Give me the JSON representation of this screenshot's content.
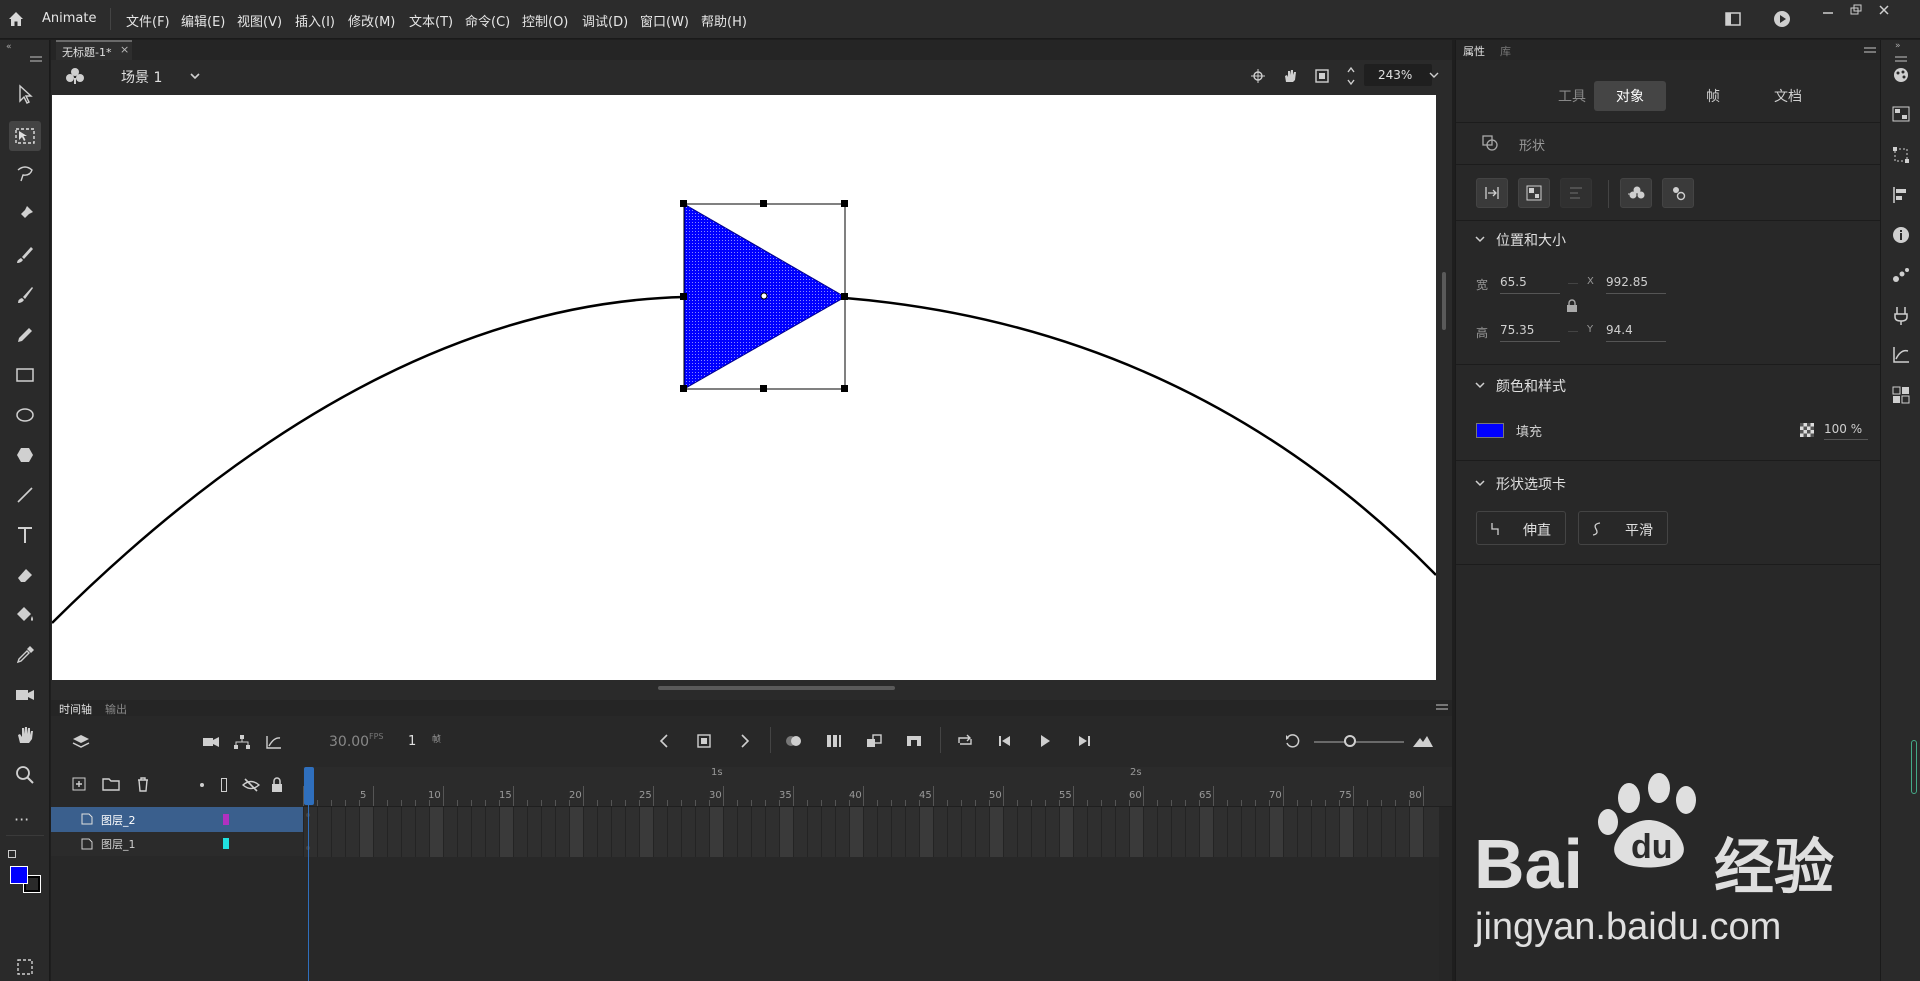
{
  "app": {
    "name": "Animate"
  },
  "menu": [
    "文件(F)",
    "编辑(E)",
    "视图(V)",
    "插入(I)",
    "修改(M)",
    "文本(T)",
    "命令(C)",
    "控制(O)",
    "调试(D)",
    "窗口(W)",
    "帮助(H)"
  ],
  "document": {
    "tab_title": "无标题-1*",
    "scene_label": "场景 1",
    "zoom": "243%"
  },
  "timeline": {
    "tab_active": "时间轴",
    "tab_inactive": "输出",
    "fps": "30.00",
    "fps_unit": "FPS",
    "frame": "1",
    "frame_unit": "帧",
    "layers": [
      {
        "name": "图层_2",
        "color": "#b030c0",
        "selected": true
      },
      {
        "name": "图层_1",
        "color": "#20e0e0",
        "selected": false
      }
    ],
    "ruler_seconds": [
      "1s",
      "2s"
    ],
    "ruler_frames": [
      "5",
      "10",
      "15",
      "20",
      "25",
      "30",
      "35",
      "40",
      "45",
      "50",
      "55",
      "60",
      "65",
      "70",
      "75",
      "80"
    ]
  },
  "properties": {
    "tab_props": "属性",
    "tab_lib": "库",
    "subtabs": [
      "工具",
      "对象",
      "帧",
      "文档"
    ],
    "active_subtab": "对象",
    "object_type": "形状",
    "section_pos": "位置和大小",
    "w_label": "宽",
    "w_value": "65.5",
    "x_label": "X",
    "x_value": "992.85",
    "h_label": "高",
    "h_value": "75.35",
    "y_label": "Y",
    "y_value": "94.4",
    "section_color": "颜色和样式",
    "fill_label": "填充",
    "fill_color": "#0000ff",
    "fill_alpha": "100 %",
    "section_shape": "形状选项卡",
    "straighten_label": "伸直",
    "smooth_label": "平滑"
  },
  "colors": {
    "stroke": "#000000",
    "fill": "#0000ff",
    "accent": "#2f6fbd",
    "watermark_text": "jingyan.baidu.com"
  }
}
